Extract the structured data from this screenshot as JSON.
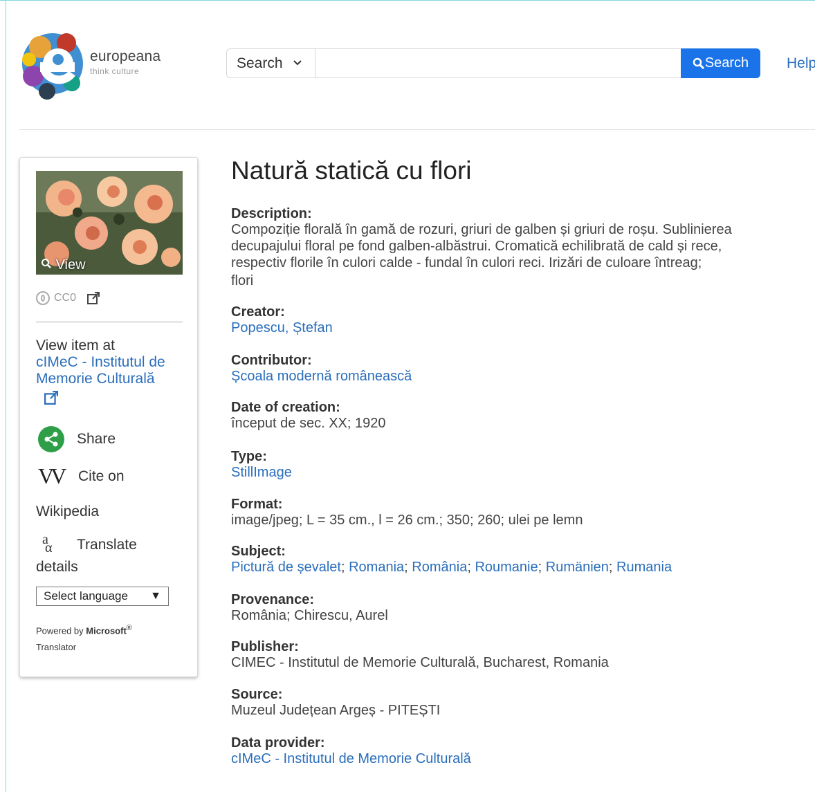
{
  "header": {
    "logo_text": "europeana",
    "logo_tagline": "think culture",
    "search_select_label": "Search",
    "search_placeholder": "",
    "search_button_label": "Search",
    "help_link": "Help"
  },
  "sidebar": {
    "view_label": "View",
    "license": "CC0",
    "view_item_at": "View item at",
    "provider_link": "cIMeC - Institutul de Memorie Culturală",
    "share_label": "Share",
    "cite_label": "Cite on",
    "cite_label_2": "Wikipedia",
    "translate_label": "Translate",
    "translate_label_2": "details",
    "language_select": "Select language",
    "powered_by": "Powered by",
    "powered_brand": "Microsoft",
    "powered_reg": "®",
    "powered_product": "Translator"
  },
  "item": {
    "title": "Natură statică cu flori",
    "description_label": "Description:",
    "description_lines": [
      "Compoziție florală în gamă de rozuri, griuri de galben și griuri de roșu. Sublinierea",
      "decupajului floral pe fond galben-albăstrui. Cromatică echilibrată de cald și rece,",
      "respectiv florile în culori calde - fundal în culori reci. Irizări de culoare întreag;"
    ],
    "description_extra": "flori",
    "creator_label": "Creator:",
    "creator": "Popescu, Ștefan",
    "contributor_label": "Contributor:",
    "contributor": "Școala modernă românească",
    "date_label": "Date of creation:",
    "date": "început de sec. XX; 1920",
    "type_label": "Type:",
    "type": "StillImage",
    "format_label": "Format:",
    "format": "image/jpeg; L = 35 cm., l = 26 cm.; 350; 260; ulei pe lemn",
    "subject_label": "Subject:",
    "subjects": [
      "Pictură de șevalet",
      "Romania",
      "România",
      "Roumanie",
      "Rumänien",
      "Rumania"
    ],
    "provenance_label": "Provenance:",
    "provenance": "România; Chirescu, Aurel",
    "publisher_label": "Publisher:",
    "publisher": "CIMEC - Institutul de Memorie Culturală, Bucharest, Romania",
    "source_label": "Source:",
    "source": "Muzeul Județean Argeș - PITEȘTI",
    "data_provider_label": "Data provider:",
    "data_provider": "cIMeC - Institutul de Memorie Culturală"
  },
  "colors": {
    "accent": "#1a73e8",
    "link": "#2a6ebb",
    "share_green": "#2e9e48"
  }
}
